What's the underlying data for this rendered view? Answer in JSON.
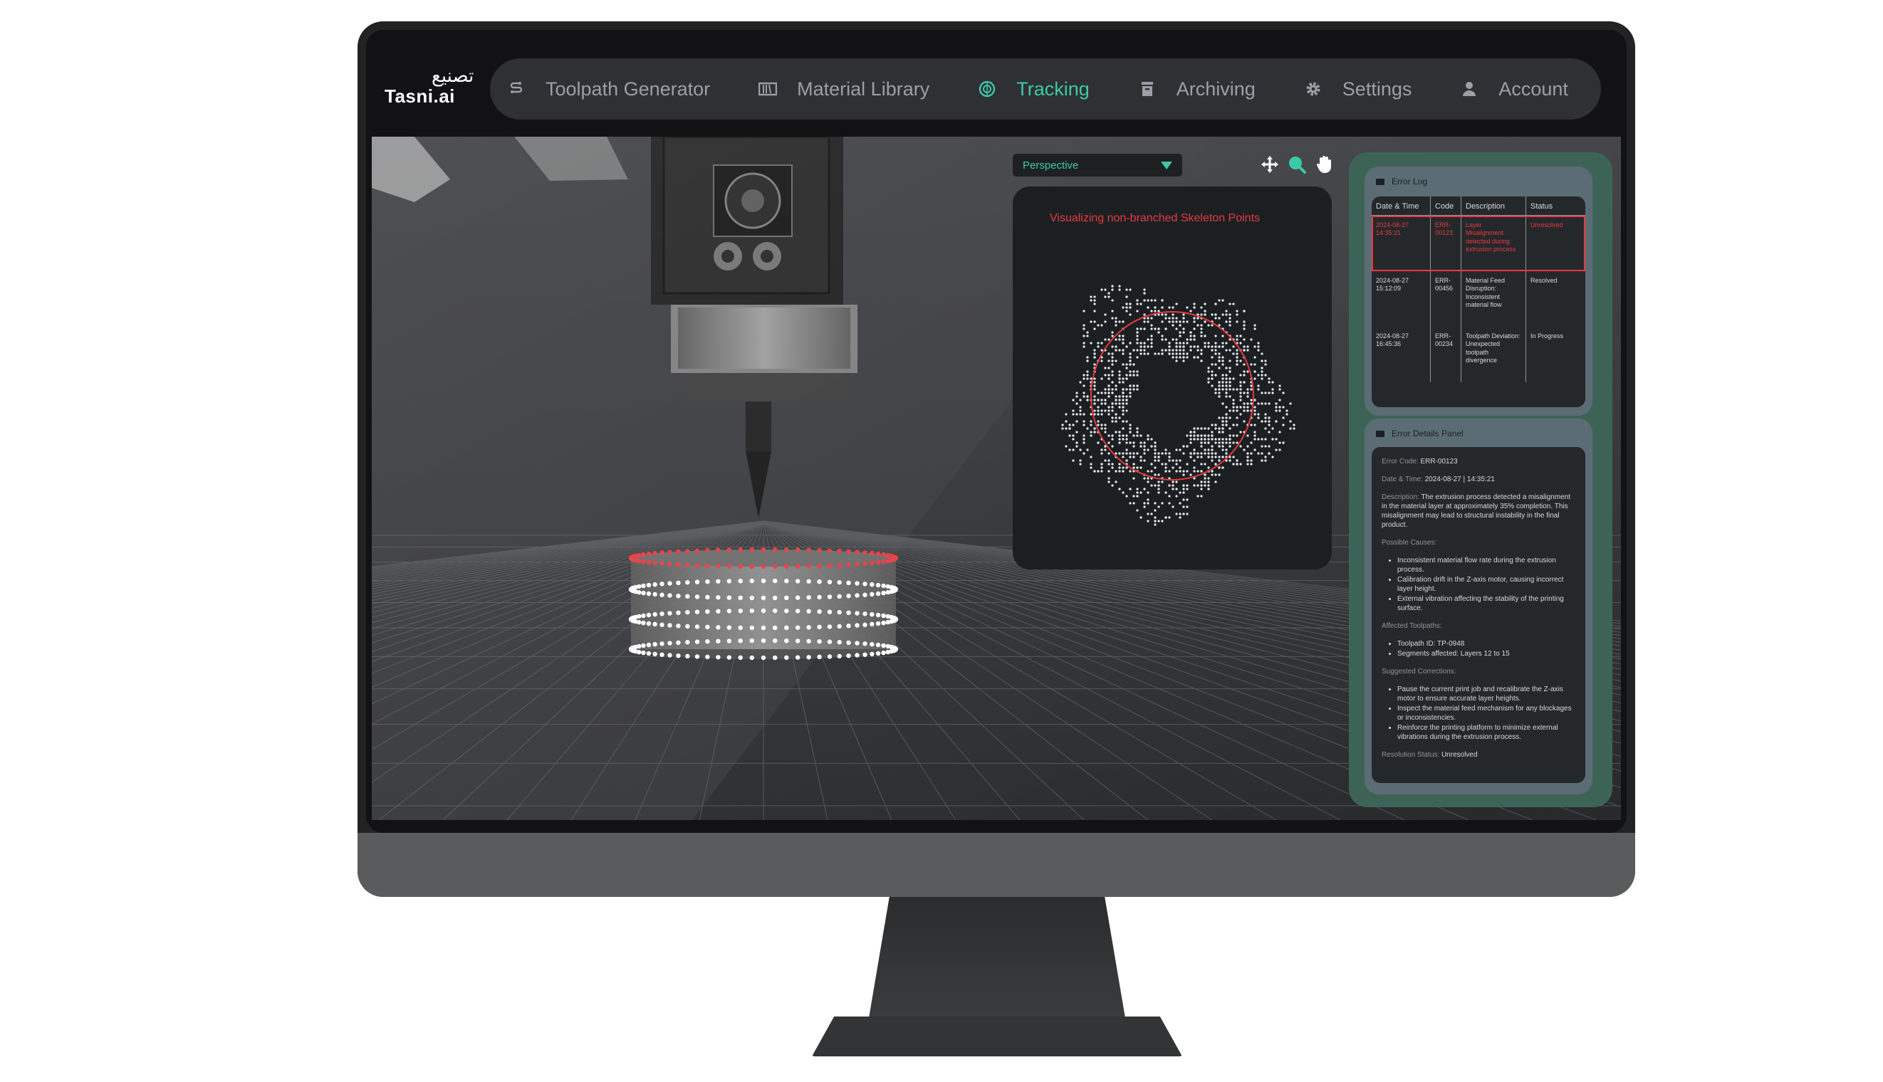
{
  "brand": {
    "name_arabic": "تصنيع",
    "name_latin": "Tasni.ai"
  },
  "nav": [
    {
      "label": "Toolpath Generator",
      "icon": "toolpath-icon",
      "active": false
    },
    {
      "label": "Material Library",
      "icon": "library-icon",
      "active": false
    },
    {
      "label": "Tracking",
      "icon": "tracking-icon",
      "active": true
    },
    {
      "label": "Archiving",
      "icon": "archive-icon",
      "active": false
    },
    {
      "label": "Settings",
      "icon": "gear-icon",
      "active": false
    },
    {
      "label": "Account",
      "icon": "user-icon",
      "active": false
    }
  ],
  "viewport": {
    "view_mode": "Perspective",
    "tools": [
      "move-icon",
      "zoom-icon",
      "pan-hand-icon"
    ]
  },
  "skeleton_panel": {
    "title": "Visualizing non-branched Skeleton Points"
  },
  "error_log": {
    "title": "Error Log",
    "columns": [
      "Date & Time",
      "Code",
      "Description",
      "Status"
    ],
    "rows": [
      {
        "datetime": "2024-08-27 14:35:21",
        "code": "ERR-00123",
        "description": "Layer Misalignment detected during extrusion process",
        "status": "Unresolved",
        "selected": true
      },
      {
        "datetime": "2024-08-27 15:12:09",
        "code": "ERR-00456",
        "description": "Material Feed Disruption: Inconsistent material flow",
        "status": "Resolved",
        "selected": false
      },
      {
        "datetime": "2024-08-27 16:45:36",
        "code": "ERR-00234",
        "description": "Toolpath Deviation: Unexpected toolpath divergence",
        "status": "In Progress",
        "selected": false
      }
    ]
  },
  "error_details": {
    "title": "Error Details Panel",
    "code_label": "Error Code:",
    "code": "ERR-00123",
    "datetime_label": "Date & Time:",
    "datetime": "2024-08-27 | 14:35:21",
    "description_label": "Description:",
    "description": "The extrusion process detected a misalignment in the material layer at approximately 35% completion. This misalignment may lead to structural instability in the final product.",
    "causes_label": "Possible Causes:",
    "causes": [
      "Inconsistent material flow rate during the extrusion process.",
      "Calibration drift in the Z-axis motor, causing incorrect layer height.",
      "External vibration affecting the stability of the printing surface."
    ],
    "toolpaths_label": "Affected Toolpaths:",
    "toolpaths": [
      "Toolpath ID: TP-0948",
      "Segments affected: Layers 12 to 15"
    ],
    "corrections_label": "Suggested Corrections:",
    "corrections": [
      "Pause the current print job and recalibrate the Z-axis motor to ensure accurate layer heights.",
      "Inspect the material feed mechanism for any blockages or inconsistencies.",
      "Reinforce the printing platform to minimize external vibrations during the extrusion process."
    ],
    "status_label": "Resolution Status:",
    "status": "Unresolved"
  },
  "colors": {
    "accent": "#3cc9a8",
    "alert": "#e63a42",
    "panel_green": "#3d6357"
  }
}
